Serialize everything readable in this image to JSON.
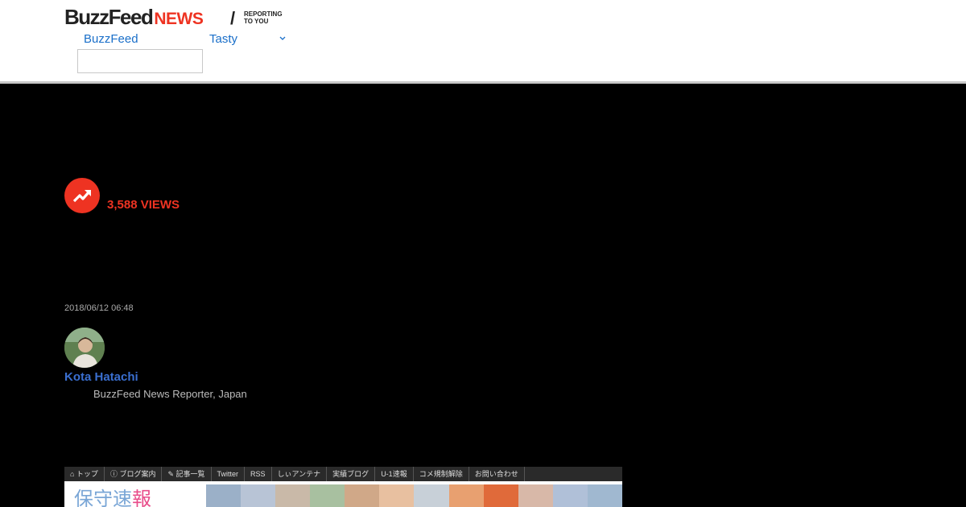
{
  "header": {
    "logo_buzzfeed": "BuzzFeed",
    "logo_news": "NEWS",
    "logo_slash": "/",
    "tagline_line1": "REPORTING",
    "tagline_line2": "TO YOU",
    "nav": [
      {
        "label": "BuzzFeed"
      },
      {
        "label": "Tasty"
      }
    ],
    "search_value": ""
  },
  "stats": {
    "views": "3,588 VIEWS"
  },
  "article": {
    "timestamp": "2018/06/12 06:48",
    "author_name": "Kota Hatachi",
    "author_title": "BuzzFeed News Reporter, Japan"
  },
  "embed": {
    "menu": [
      "⌂ トップ",
      "ⓘ ブログ案内",
      "✎ 記事一覧",
      "Twitter",
      "RSS",
      "しぃアンテナ",
      "実績ブログ",
      "U-1速報",
      "コメ規制解除",
      "お問い合わせ"
    ],
    "title_blue": "保守速",
    "title_pink": "報"
  },
  "colors": {
    "accent_red": "#ee3322",
    "link_blue": "#1a6fc9",
    "author_blue": "#3a6fd0"
  }
}
